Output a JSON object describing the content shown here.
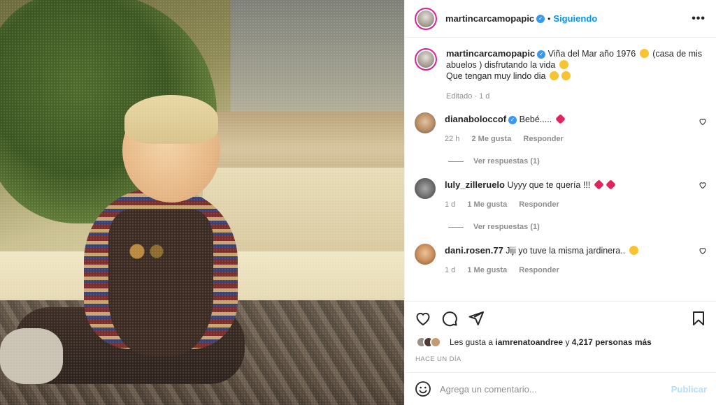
{
  "post": {
    "author": "martincarcamopapic",
    "follow_status": "Siguiendo",
    "caption_line1": "Viña del Mar año 1976",
    "caption_line2": "(casa de mis abuelos ) disfrutando la vida",
    "caption_line3": "Que tengan muy lindo dia",
    "edited": "Editado · 1 d",
    "more_icon": "•••"
  },
  "comments": [
    {
      "user": "dianaboloccof",
      "verified": true,
      "text": "Bebé.....",
      "time": "22 h",
      "likes": "2 Me gusta",
      "reply": "Responder",
      "view_replies": "Ver respuestas (1)"
    },
    {
      "user": "luly_zilleruelo",
      "verified": false,
      "text": "Uyyy que te quería !!!",
      "time": "1 d",
      "likes": "1 Me gusta",
      "reply": "Responder",
      "view_replies": "Ver respuestas (1)"
    },
    {
      "user": "dani.rosen.77",
      "verified": false,
      "text": "Jiji yo tuve la misma jardinera..",
      "time": "1 d",
      "likes": "1 Me gusta",
      "reply": "Responder"
    }
  ],
  "likes": {
    "prefix": "Les gusta a",
    "user": "iamrenatoandree",
    "joiner": "y",
    "count": "4,217 personas más"
  },
  "timestamp": "HACE UN DÍA",
  "composer": {
    "placeholder": "Agrega un comentario...",
    "publish": "Publicar"
  },
  "icons": [
    "like-icon",
    "comment-icon",
    "share-icon",
    "bookmark-icon",
    "emoji-icon",
    "more-icon",
    "verified-icon"
  ],
  "colors": {
    "accent": "#0095f6",
    "publish_disabled": "#b2dffc",
    "verified": "#3897f0",
    "muted": "#8e8e8e"
  }
}
